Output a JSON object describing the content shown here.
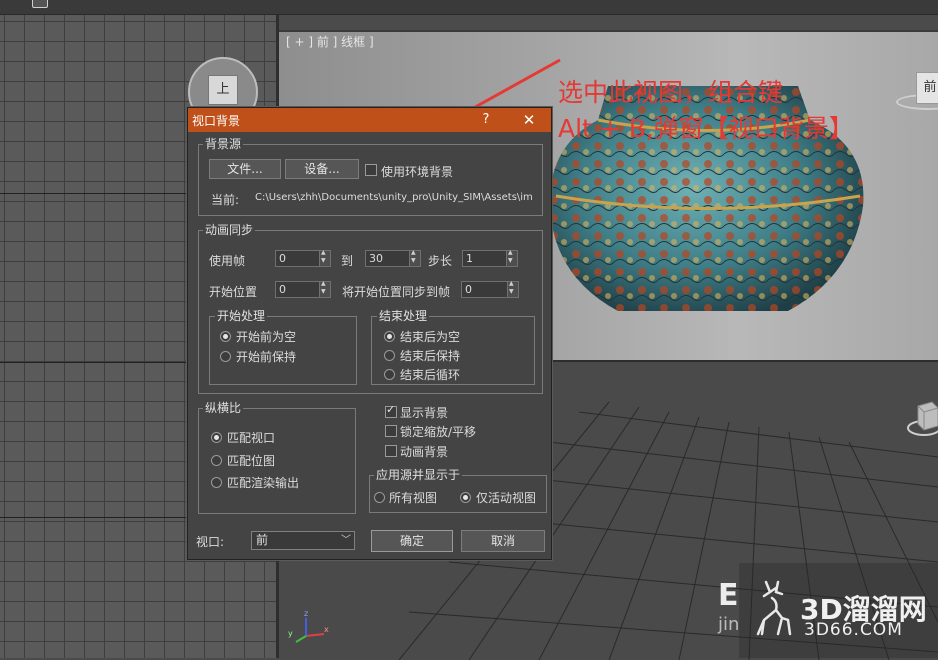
{
  "viewport": {
    "front_label": "[ + ] 前 ] 线框 ]",
    "left_cube_face": "上",
    "front_cube_face": "前"
  },
  "annotation": {
    "line1": "选中此视图，组合键",
    "line2": "Alt + B,弹窗【视口背景】",
    "color": "#e53935"
  },
  "watermark": {
    "brand": "3D溜溜网",
    "url": "3D66.COM",
    "partial_text_top": "E",
    "partial_text_bottom": "jin"
  },
  "dialog": {
    "title": "视口背景",
    "help_label": "?",
    "close_label": "✕",
    "title_color": "#c0501a",
    "source": {
      "legend": "背景源",
      "files_button": "文件...",
      "devices_button": "设备...",
      "use_env_label": "使用环境背景",
      "use_env_checked": false,
      "current_label": "当前:",
      "current_path": "C:\\Users\\zhh\\Documents\\unity_pro\\Unity_SIM\\Assets\\im"
    },
    "animation": {
      "legend": "动画同步",
      "use_frame_label": "使用帧",
      "use_frame_value": "0",
      "to_label": "到",
      "to_value": "30",
      "step_label": "步长",
      "step_value": "1",
      "start_pos_label": "开始位置",
      "start_pos_value": "0",
      "sync_label": "将开始位置同步到帧",
      "sync_value": "0",
      "start_processing": {
        "legend": "开始处理",
        "options": [
          "开始前为空",
          "开始前保持"
        ],
        "selected": 0
      },
      "end_processing": {
        "legend": "结束处理",
        "options": [
          "结束后为空",
          "结束后保持",
          "结束后循环"
        ],
        "selected": 0
      }
    },
    "aspect": {
      "legend": "纵横比",
      "options": [
        "匹配视口",
        "匹配位图",
        "匹配渲染输出"
      ],
      "selected": 0
    },
    "options": {
      "show_background": {
        "label": "显示背景",
        "checked": true
      },
      "lock_zoom_pan": {
        "label": "锁定缩放/平移",
        "checked": false
      },
      "animate_background": {
        "label": "动画背景",
        "checked": false
      }
    },
    "apply_to": {
      "legend": "应用源并显示于",
      "options": [
        "所有视图",
        "仅活动视图"
      ],
      "selected": 1
    },
    "viewport_label": "视口:",
    "viewport_value": "前",
    "ok_button": "确定",
    "cancel_button": "取消"
  }
}
